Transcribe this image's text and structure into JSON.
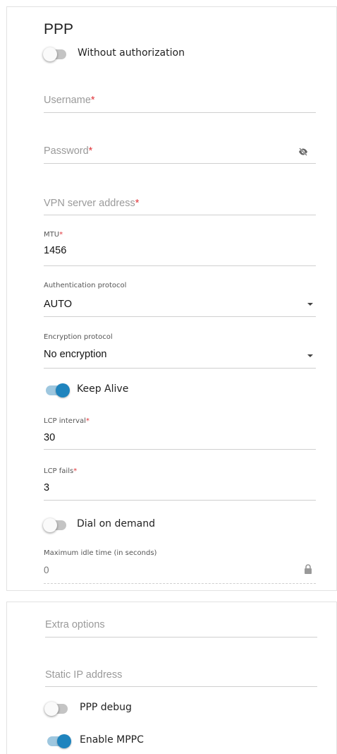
{
  "ppp": {
    "title": "PPP",
    "without_auth": {
      "label": "Without authorization",
      "on": false
    },
    "username": {
      "label": "Username",
      "required": "*"
    },
    "password": {
      "label": "Password",
      "required": "*"
    },
    "vpn_server": {
      "label": "VPN server address",
      "required": "*"
    },
    "mtu": {
      "label": "MTU",
      "required": "*",
      "value": "1456"
    },
    "auth_protocol": {
      "label": "Authentication protocol",
      "value": "AUTO"
    },
    "encryption_protocol": {
      "label": "Encryption protocol",
      "value": "No encryption"
    },
    "keep_alive": {
      "label": "Keep Alive",
      "on": true
    },
    "lcp_interval": {
      "label": "LCP interval",
      "required": "*",
      "value": "30"
    },
    "lcp_fails": {
      "label": "LCP fails",
      "required": "*",
      "value": "3"
    },
    "dial_on_demand": {
      "label": "Dial on demand",
      "on": false
    },
    "max_idle": {
      "label": "Maximum idle time (in seconds)",
      "value": "0"
    }
  },
  "extra": {
    "extra_options": {
      "label": "Extra options"
    },
    "static_ip": {
      "label": "Static IP address"
    },
    "ppp_debug": {
      "label": "PPP debug",
      "on": false
    },
    "enable_mppc": {
      "label": "Enable MPPC",
      "on": true
    }
  },
  "icons": [
    "eye-off-icon",
    "lock-icon",
    "chevron-down-icon"
  ],
  "colors": {
    "accent": "#1f84be",
    "required": "#e0363b"
  }
}
